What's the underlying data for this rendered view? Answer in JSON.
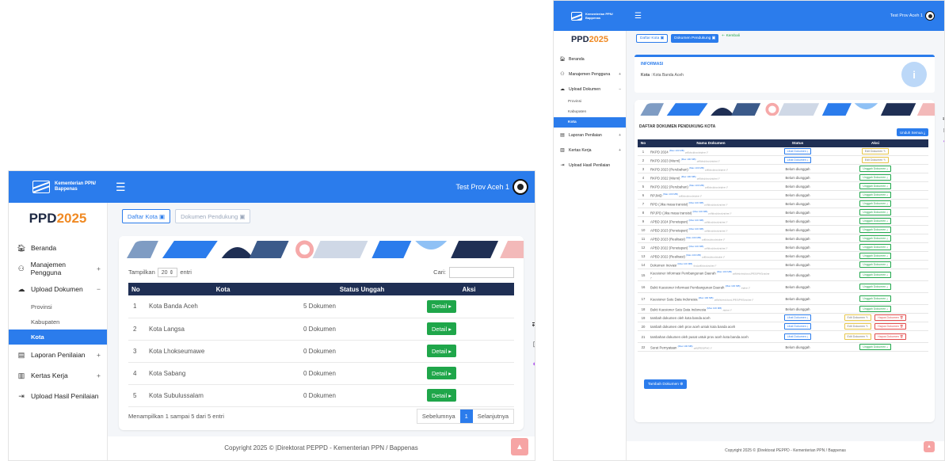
{
  "brand": {
    "line1": "Kementerian PPN/",
    "line2": "Bappenas",
    "logo_text": "PPD",
    "logo_year": "2025"
  },
  "user": {
    "name": "Test Prov Aceh 1"
  },
  "nav": {
    "beranda": "Beranda",
    "manajemen": "Manajemen Pengguna",
    "upload_dokumen": "Upload Dokumen",
    "sub": [
      "Provinsi",
      "Kabupaten",
      "Kota"
    ],
    "laporan": "Laporan Penilaian",
    "kertas": "Kertas Kerja",
    "upload_hasil": "Upload Hasil Penilaian",
    "plus": "+",
    "minus": "−"
  },
  "left": {
    "btn_daftar": "Daftar Kota",
    "btn_dokumen": "Dokumen Pendukung",
    "show_label": "Tampilkan",
    "show_value": "20",
    "show_suffix": "entri",
    "search_label": "Cari:",
    "headers": [
      "No",
      "Kota",
      "Status Unggah",
      "Aksi"
    ],
    "rows": [
      {
        "no": "1",
        "kota": "Kota Banda Aceh",
        "status": "5 Dokumen",
        "aksi": "Detail"
      },
      {
        "no": "2",
        "kota": "Kota Langsa",
        "status": "0 Dokumen",
        "aksi": "Detail"
      },
      {
        "no": "3",
        "kota": "Kota Lhokseumawe",
        "status": "0 Dokumen",
        "aksi": "Detail"
      },
      {
        "no": "4",
        "kota": "Kota Sabang",
        "status": "0 Dokumen",
        "aksi": "Detail"
      },
      {
        "no": "5",
        "kota": "Kota Subulussalam",
        "status": "0 Dokumen",
        "aksi": "Detail"
      }
    ],
    "info_text": "Menampilkan 1 sampai 5 dari 5 entri",
    "prev": "Sebelumnya",
    "page": "1",
    "next": "Selanjutnya"
  },
  "right": {
    "btn_daftar": "Daftar Kota",
    "btn_dokumen": "Dokumen Pendukung",
    "kembali": "Kembali",
    "info_title": "INFORMASI",
    "info_label": "Kota",
    "info_value": "Kota Banda Aceh",
    "info_icon": "i",
    "table_title": "DAFTAR DOKUMEN PENDUKUNG KOTA",
    "unduh": "Unduh Semua",
    "headers": [
      "No",
      "Nama Dokumen",
      "Status",
      "Aksi"
    ],
    "rows": [
      {
        "no": "1",
        "nama": "RKPD 2024",
        "sub": "(Max 100 MB)",
        "hint": "pdf|doc|docx|zip|rar )*",
        "status": "Lihat Dokumen",
        "status_kind": "link",
        "aksi": [
          "Edit Dokumen"
        ]
      },
      {
        "no": "2",
        "nama": "RKPD 2023 (Murni)",
        "sub": "(Max 100 MB)",
        "hint": "pdf|doc|docx|zip|rar )*",
        "status": "Lihat Dokumen",
        "status_kind": "link",
        "aksi": [
          "Edit Dokumen"
        ]
      },
      {
        "no": "3",
        "nama": "RKPD 2023 (Perubahan)",
        "sub": "(Max 100 MB)",
        "hint": "pdf|doc|docx|zip|rar )*",
        "status": "Belum diunggah",
        "status_kind": "text",
        "aksi": [
          "Unggah Dokumen"
        ]
      },
      {
        "no": "4",
        "nama": "RKPD 2022 (Murni)",
        "sub": "(Max 100 MB)",
        "hint": "pdf|doc|docx|zip|rar )*",
        "status": "Belum diunggah",
        "status_kind": "text",
        "aksi": [
          "Unggah Dokumen"
        ]
      },
      {
        "no": "5",
        "nama": "RKPD 2022 (Perubahan)",
        "sub": "(Max 100 MB)",
        "hint": "pdf|doc|docx|zip|rar )*",
        "status": "Belum diunggah",
        "status_kind": "text",
        "aksi": [
          "Unggah Dokumen"
        ]
      },
      {
        "no": "6",
        "nama": "RPJMD",
        "sub": "(Max 100 MB)",
        "hint": "pdf|doc|docx|zip|rar )*",
        "status": "Belum diunggah",
        "status_kind": "text",
        "aksi": [
          "Unggah Dokumen"
        ]
      },
      {
        "no": "7",
        "nama": "RPD (Jika masa transisi)",
        "sub": "(Max 100 MB)",
        "hint": "pdf|doc|docx|zip|rar )*",
        "status": "Belum diunggah",
        "status_kind": "text",
        "aksi": [
          "Unggah Dokumen"
        ]
      },
      {
        "no": "8",
        "nama": "RPJPD (Jika masa transisi)",
        "sub": "(Max 100 MB)",
        "hint": "pdf|doc|docx|zip|rar )*",
        "status": "Belum diunggah",
        "status_kind": "text",
        "aksi": [
          "Unggah Dokumen"
        ]
      },
      {
        "no": "9",
        "nama": "APBD 2024 (Penetapan)",
        "sub": "(Max 100 MB)",
        "hint": "pdf|doc|docx|zip|rar )*",
        "status": "Belum diunggah",
        "status_kind": "text",
        "aksi": [
          "Unggah Dokumen"
        ]
      },
      {
        "no": "10",
        "nama": "APBD 2023 (Penetapan)",
        "sub": "(Max 100 MB)",
        "hint": "pdf|doc|docx|zip|rar )*",
        "status": "Belum diunggah",
        "status_kind": "text",
        "aksi": [
          "Unggah Dokumen"
        ]
      },
      {
        "no": "11",
        "nama": "APBD 2023 (Realisasi)",
        "sub": "(Max 100 MB)",
        "hint": "pdf|doc|docx|zip|rar )*",
        "status": "Belum diunggah",
        "status_kind": "text",
        "aksi": [
          "Unggah Dokumen"
        ]
      },
      {
        "no": "12",
        "nama": "APBD 2022 (Penetapan)",
        "sub": "(Max 100 MB)",
        "hint": "pdf|doc|docx|zip|rar )*",
        "status": "Belum diunggah",
        "status_kind": "text",
        "aksi": [
          "Unggah Dokumen"
        ]
      },
      {
        "no": "13",
        "nama": "APBD 2022 (Realisasi)",
        "sub": "(Max 100 MB)",
        "hint": "pdf|doc|docx|zip|rar )*",
        "status": "Belum diunggah",
        "status_kind": "text",
        "aksi": [
          "Unggah Dokumen"
        ]
      },
      {
        "no": "14",
        "nama": "Dokumen Inovasi",
        "sub": "(Max 100 MB)",
        "hint": "doc|pdf|docx|zip|rar )*",
        "status": "Belum diunggah",
        "status_kind": "text",
        "aksi": [
          "Unggah Dokumen"
        ]
      },
      {
        "no": "15",
        "nama": "Kuesioner Informasi Pembangunan Daerah",
        "sub": "(Max 100 MB)",
        "hint": "pdf|xls|xlsx|docx|JPEG|PNG|zip|rar )*",
        "status": "Belum diunggah",
        "status_kind": "text",
        "aksi": [
          "Unggah Dokumen"
        ],
        "tall": true
      },
      {
        "no": "16",
        "nama": "Bukti Kuesioner Informasi Pembangunan Daerah",
        "sub": "(Max 100 MB)",
        "hint": "zip|rar )*",
        "status": "Belum diunggah",
        "status_kind": "text",
        "aksi": [
          "Unggah Dokumen"
        ],
        "tall": true
      },
      {
        "no": "17",
        "nama": "Kuesioner Satu Data Indonesia",
        "sub": "(Max 100 MB)",
        "hint": "pdf|xls|xlsx|docx|JPEG|PNG|zip|rar )*",
        "status": "Belum diunggah",
        "status_kind": "text",
        "aksi": [
          "Unggah Dokumen"
        ],
        "tall": true
      },
      {
        "no": "18",
        "nama": "Bukti Kuesioner Satu Data Indonesia",
        "sub": "(Max 100 MB)",
        "hint": "zip|rar )*",
        "status": "Belum diunggah",
        "status_kind": "text",
        "aksi": [
          "Unggah Dokumen"
        ]
      },
      {
        "no": "19",
        "nama": "tambah dokumen oleh kota banda aceh",
        "sub": "",
        "hint": "",
        "status": "Lihat Dokumen",
        "status_kind": "link",
        "aksi": [
          "Edit Dokumen",
          "Hapus Dokumen"
        ]
      },
      {
        "no": "20",
        "nama": "tambah dokumen oleh prov aceh untuk kota banda aceh",
        "sub": "",
        "hint": "",
        "status": "Lihat Dokumen",
        "status_kind": "link",
        "aksi": [
          "Edit Dokumen",
          "Hapus Dokumen"
        ]
      },
      {
        "no": "21",
        "nama": "tambahan dokumen oleh pusat untuk prov aceh kota banda aceh",
        "sub": "",
        "hint": "",
        "status": "Lihat Dokumen",
        "status_kind": "link",
        "aksi": [
          "Edit Dokumen",
          "Hapus Dokumen"
        ],
        "tall": true
      },
      {
        "no": "22",
        "nama": "Surat Pernyataan",
        "sub": "(Max 100 MB)",
        "hint": "pdf|JPEG|PNG )*",
        "status": "Belum diunggah",
        "status_kind": "text",
        "aksi": [
          "Unggah Dokumen"
        ]
      }
    ],
    "tambah": "Tambah Dokumen"
  },
  "footer": {
    "text": "Copyright 2025 © |Direktorat PEPPD - Kementerian PPN / Bappenas"
  },
  "colors": {
    "primary": "#2b7cec",
    "navy": "#1f2f54",
    "green": "#1fa64a",
    "red": "#e04848",
    "orange": "#f08a24"
  }
}
